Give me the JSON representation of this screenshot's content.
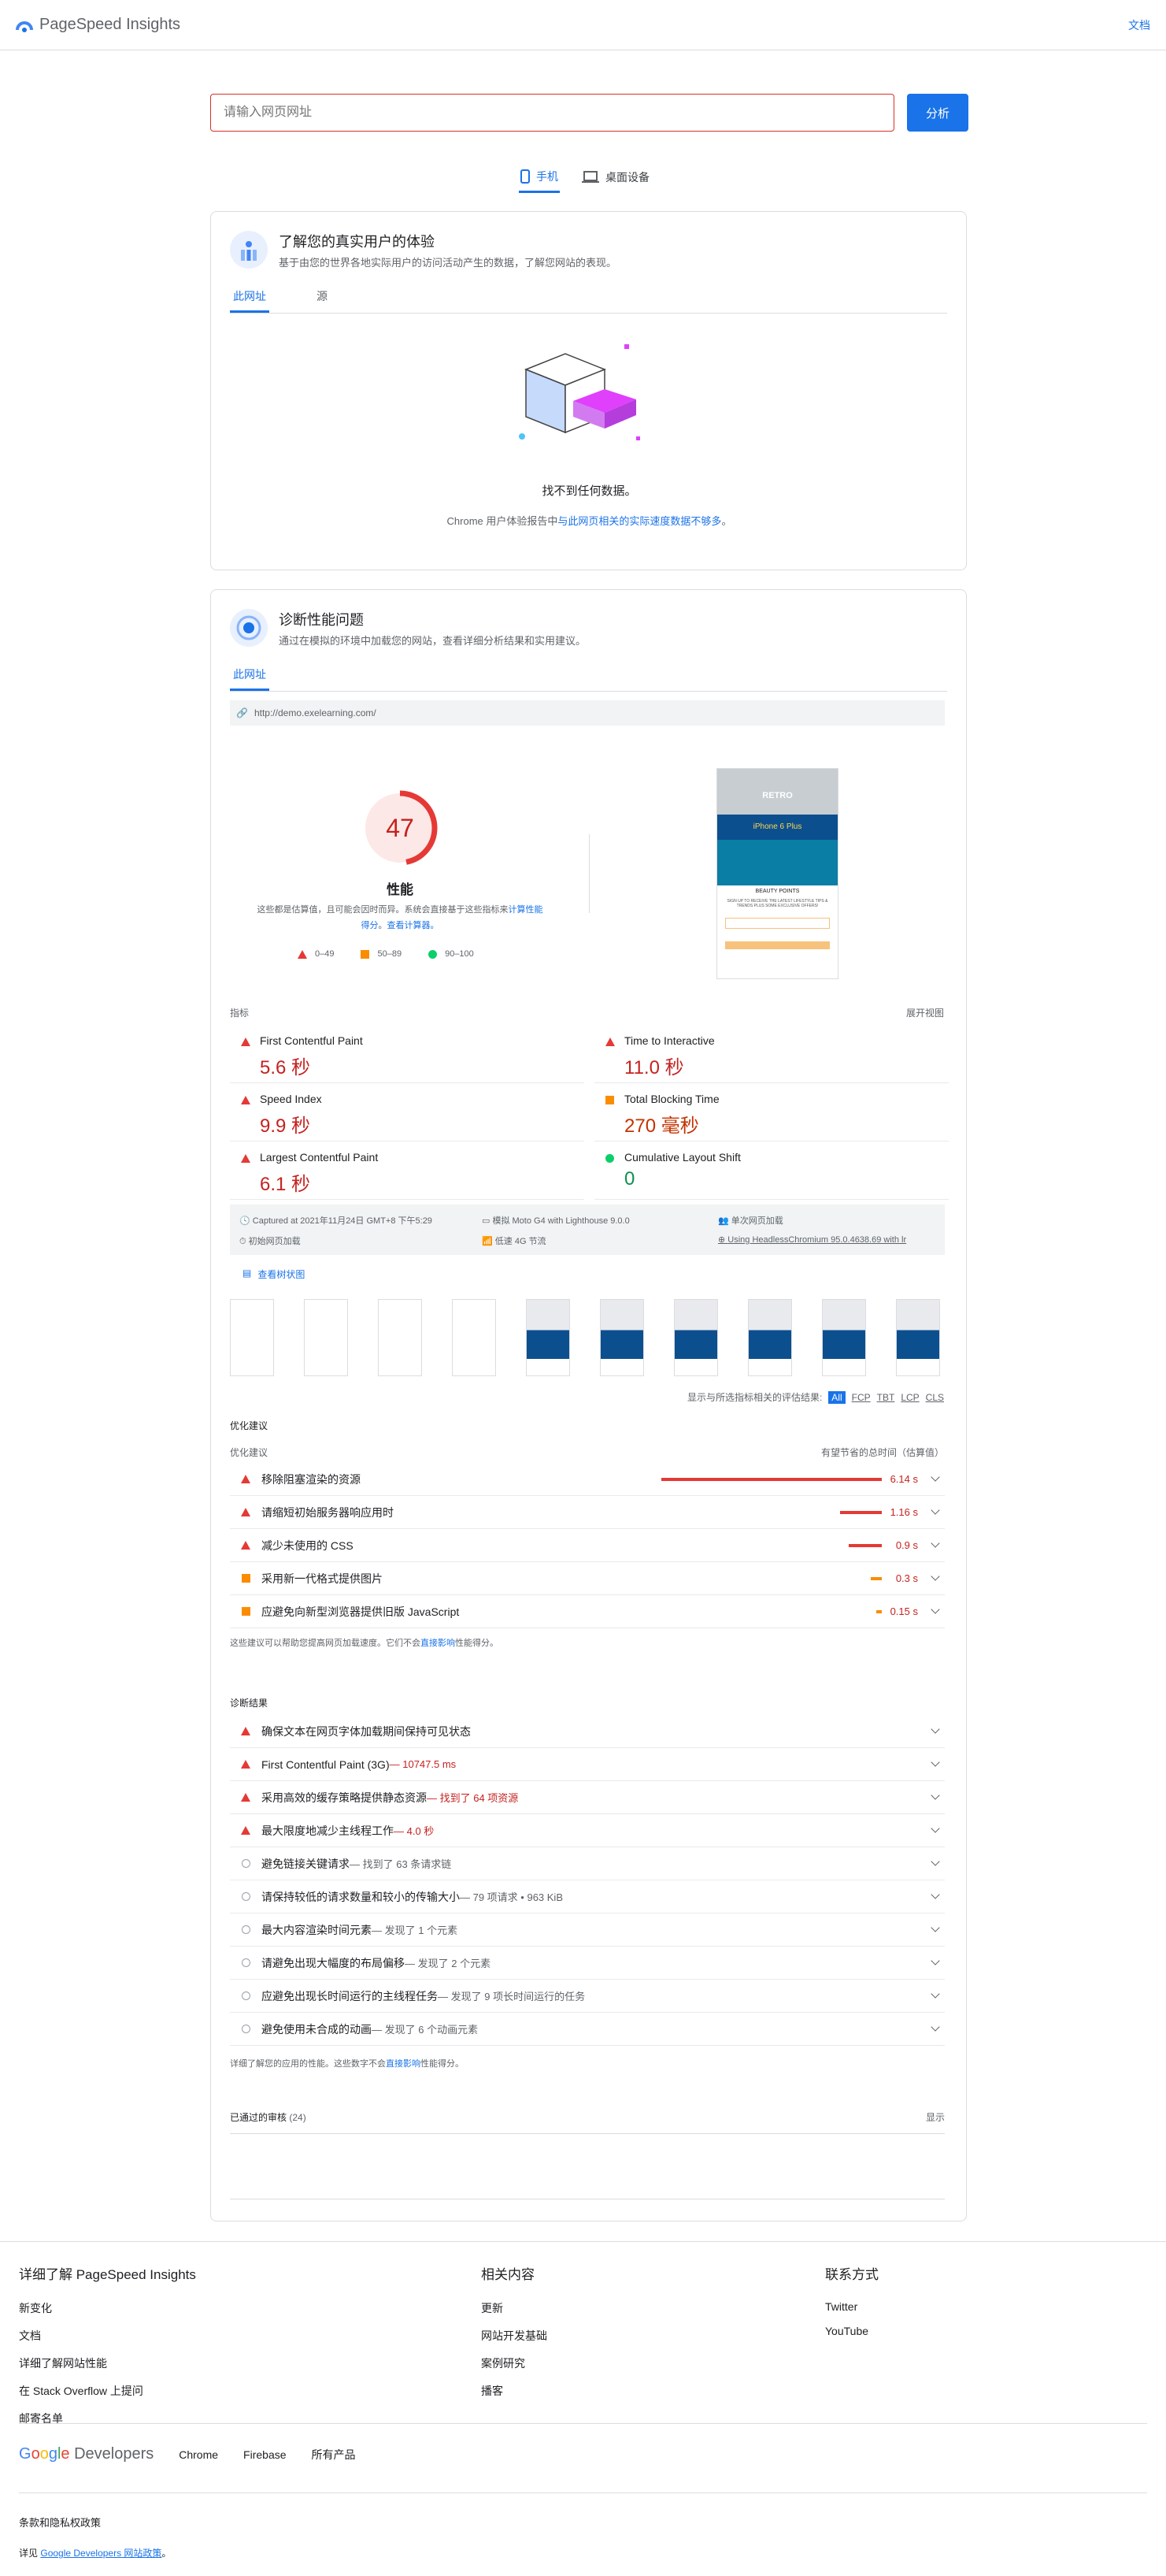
{
  "header": {
    "title": "PageSpeed Insights",
    "docs": "文档"
  },
  "search": {
    "placeholder": "请输入网页网址",
    "button": "分析"
  },
  "device_tabs": [
    "手机",
    "桌面设备"
  ],
  "field": {
    "title": "了解您的真实用户的体验",
    "subtitle": "基于由您的世界各地实际用户的访问活动产生的数据，了解您网站的表现。",
    "tabs": [
      "此网址",
      "源"
    ],
    "no_data": "找不到任何数据。",
    "message_prefix": "Chrome 用户体验报告中",
    "message_link": "与此网页相关的实际速度数据不",
    "message_link2": "够多",
    "message_suffix": "。"
  },
  "lab": {
    "title": "诊断性能问题",
    "subtitle": "通过在模拟的环境中加载您的网站，查看详细分析结果和实用建议。",
    "tab": "此网址",
    "url": "http://demo.exelearning.com/",
    "score": "47",
    "score_label": "性能",
    "score_note1": "这些都是估算值，且可能会因时而异。系统会直接基于这些指标来",
    "score_note_link1": "计算性能",
    "score_note2": "得分",
    "score_note3": "。",
    "score_note_link2": "查看计算器。",
    "legend": [
      "0–49",
      "50–89",
      "90–100"
    ],
    "metrics_label": "指标",
    "expand_view": "展开视图",
    "metrics": [
      {
        "name": "First Contentful Paint",
        "value": "5.6 秒",
        "status": "fail"
      },
      {
        "name": "Time to Interactive",
        "value": "11.0 秒",
        "status": "fail"
      },
      {
        "name": "Speed Index",
        "value": "9.9 秒",
        "status": "fail"
      },
      {
        "name": "Total Blocking Time",
        "value": "270 毫秒",
        "status": "average"
      },
      {
        "name": "Largest Contentful Paint",
        "value": "6.1 秒",
        "status": "fail"
      },
      {
        "name": "Cumulative Layout Shift",
        "value": "0",
        "status": "pass"
      }
    ],
    "env": [
      "Captured at 2021年11月24日 GMT+8 下午5:29",
      "模拟 Moto G4 with Lighthouse 9.0.0",
      "单次网页加载",
      "初始网页加载",
      "低速 4G 节流",
      "Using HeadlessChromium 95.0.4638.69 with lr"
    ],
    "treemap": "查看树状图",
    "filter_label": "显示与所选指标相关的评估结果:",
    "filters": [
      "All",
      "FCP",
      "TBT",
      "LCP",
      "CLS"
    ],
    "screenshot_text": {
      "brand": "RETRO",
      "banner": "iPhone 6 Plus",
      "tagline": "SIGN UP TO RECEIVE THE LATEST LIFESTYLE TIPS & TRENDS PLUS SOME EXCLUSIVE OFFERS!",
      "heading": "BEAUTY POINTS"
    }
  },
  "opportunities": {
    "title": "优化建议",
    "col1": "优化建议",
    "col2": "有望节省的总时间（估算值）",
    "items": [
      {
        "label": "移除阻塞渲染的资源",
        "saving": "6.14 s",
        "status": "fail",
        "fraction": 1.0
      },
      {
        "label": "请缩短初始服务器响应用时",
        "saving": "1.16 s",
        "status": "fail",
        "fraction": 0.19
      },
      {
        "label": "减少未使用的 CSS",
        "saving": "0.9 s",
        "status": "fail",
        "fraction": 0.15
      },
      {
        "label": "采用新一代格式提供图片",
        "saving": "0.3 s",
        "status": "average",
        "fraction": 0.05
      },
      {
        "label": "应避免向新型浏览器提供旧版 JavaScript",
        "saving": "0.15 s",
        "status": "average",
        "fraction": 0.025
      }
    ],
    "note_pre": "这些建议可以帮助您提高网页加载速度。它们不会",
    "note_link": "直接影响",
    "note_post": "性能得分。"
  },
  "diagnostics": {
    "title": "诊断结果",
    "items": [
      {
        "label": "确保文本在网页字体加载期间保持可见状态",
        "detail": "",
        "status": "fail"
      },
      {
        "label": "First Contentful Paint (3G)",
        "detail": " — 10747.5 ms",
        "status": "fail"
      },
      {
        "label": "采用高效的缓存策略提供静态资源",
        "detail": " — 找到了 64 项资源",
        "status": "fail"
      },
      {
        "label": "最大限度地减少主线程工作",
        "detail": " — 4.0 秒",
        "status": "fail"
      },
      {
        "label": "避免链接关键请求",
        "detail": " — 找到了 63 条请求链",
        "status": "info"
      },
      {
        "label": "请保持较低的请求数量和较小的传输大小",
        "detail": " — 79 项请求 • 963 KiB",
        "status": "info"
      },
      {
        "label": "最大内容渲染时间元素",
        "detail": " — 发现了 1 个元素",
        "status": "info"
      },
      {
        "label": "请避免出现大幅度的布局偏移",
        "detail": " — 发现了 2 个元素",
        "status": "info"
      },
      {
        "label": "应避免出现长时间运行的主线程任务",
        "detail": " — 发现了 9 项长时间运行的任务",
        "status": "info"
      },
      {
        "label": "避免使用未合成的动画",
        "detail": " — 发现了 6 个动画元素",
        "status": "info"
      }
    ],
    "note_pre": "详细了解您的应用的性能。这些数字不会",
    "note_link": "直接影响",
    "note_post": "性能得分。"
  },
  "passed": {
    "label": "已通过的审核",
    "count": "(24)",
    "show": "显示"
  },
  "footer": {
    "col1_title": "详细了解 PageSpeed Insights",
    "col1": [
      "新变化",
      "文档",
      "详细了解网站性能",
      "在 Stack Overflow 上提问",
      "邮寄名单"
    ],
    "col2_title": "相关内容",
    "col2": [
      "更新",
      "网站开发基础",
      "案例研究",
      "播客"
    ],
    "col3_title": "联系方式",
    "col3": [
      "Twitter",
      "YouTube"
    ],
    "brand": "Developers",
    "links": [
      "Chrome",
      "Firebase",
      "所有产品"
    ],
    "policy": "条款和隐私权政策",
    "see_pre": "详见",
    "see_link": "Google Developers 网站政策",
    "see_post": "。"
  },
  "colors": {
    "fail": "#e53935",
    "average": "#fb8c00",
    "pass": "#0cce6b",
    "accent": "#1a73e8"
  }
}
